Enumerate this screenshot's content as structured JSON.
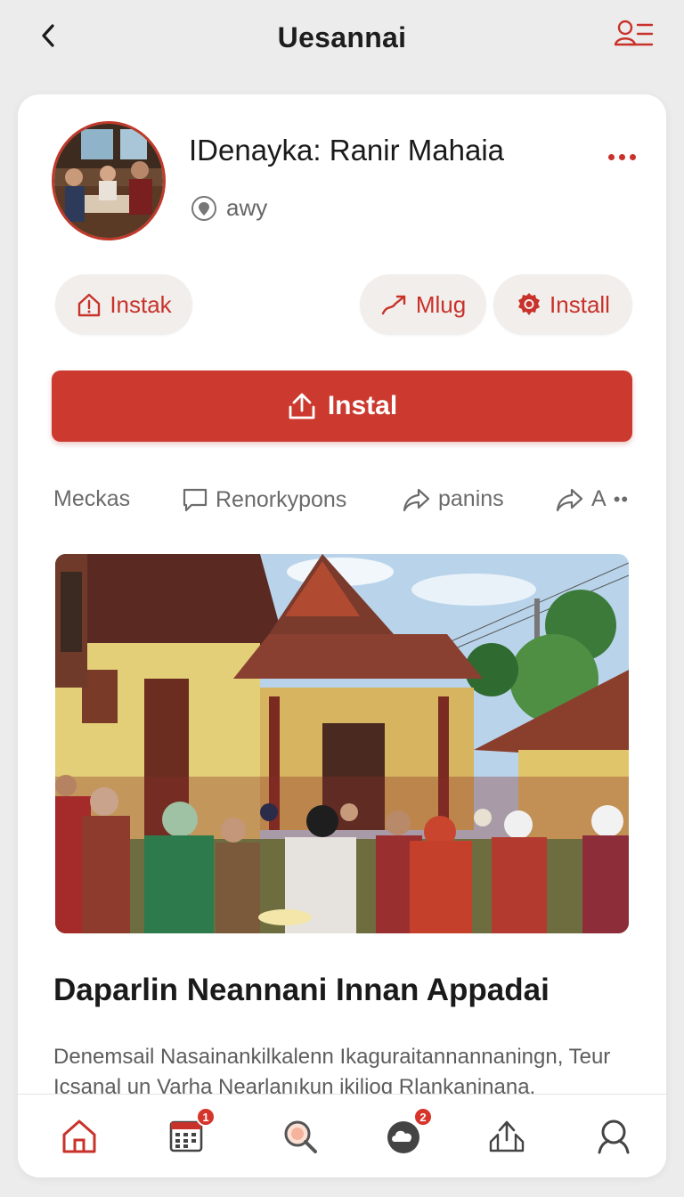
{
  "header": {
    "title": "Uesannai",
    "back_icon": "chevron-left-icon",
    "menu_icon": "user-list-icon"
  },
  "profile": {
    "name": "IDenaуka: Ranir Mahaia",
    "subtitle": "awy",
    "subtitle_icon": "location-pin-icon",
    "more_icon": "more-dots-icon"
  },
  "chips": [
    {
      "label": "Instak",
      "icon": "house-icon"
    },
    {
      "label": "Mlug",
      "icon": "trend-arrow-icon"
    },
    {
      "label": "Install",
      "icon": "badge-icon"
    }
  ],
  "primary_button": {
    "label": "Instal",
    "icon": "upload-icon"
  },
  "actions": [
    {
      "label": "Meckas"
    },
    {
      "label": "Renorkypons",
      "icon": "comment-icon"
    },
    {
      "label": "panins",
      "icon": "share-icon"
    },
    {
      "label": "A",
      "icon": "share-icon"
    }
  ],
  "post": {
    "title": "Daparlin Neannani Innan Appadai",
    "description": "Denemsail Nasainankilkalenn Ikaguraitannannaningn, Teur Icsanal un Varha Nearlanıkun ikilioq Rlankaninana."
  },
  "bottom_nav": {
    "items": [
      {
        "icon": "home-icon",
        "active": true
      },
      {
        "icon": "calendar-icon",
        "badge": "1"
      },
      {
        "icon": "search-icon"
      },
      {
        "icon": "chat-cloud-icon",
        "badge": "2"
      },
      {
        "icon": "upload-icon"
      },
      {
        "icon": "profile-search-icon"
      }
    ]
  },
  "colors": {
    "accent": "#cc3a2f",
    "background": "#ececec",
    "card": "#ffffff",
    "chip": "#f1eeec"
  }
}
